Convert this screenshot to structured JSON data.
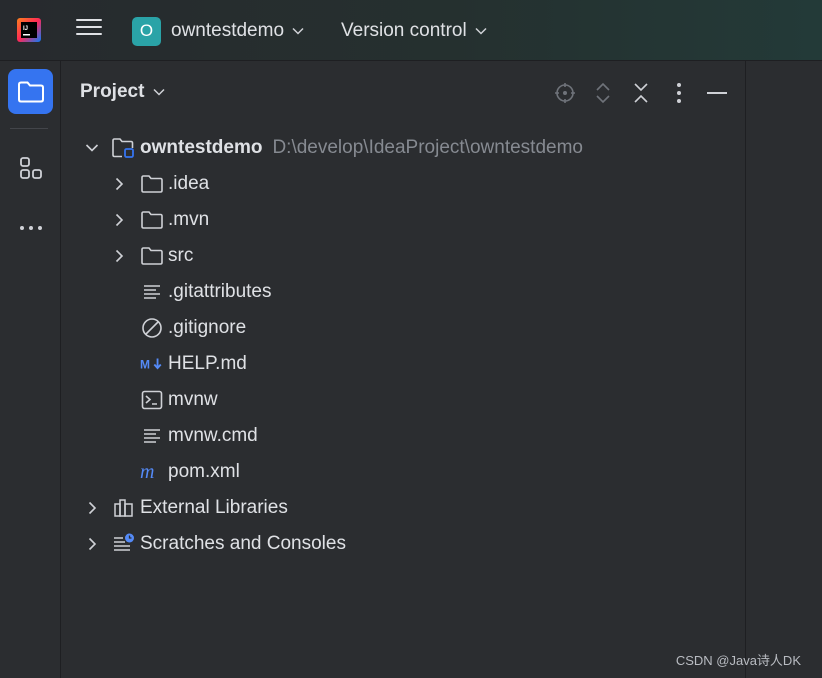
{
  "titlebar": {
    "logo_icon": "intellij-idea-logo",
    "menu_icon": "hamburger-menu-icon",
    "project": {
      "badge": "O",
      "name": "owntestdemo",
      "badge_color": "#2aa3a7"
    },
    "vcs": {
      "label": "Version control"
    }
  },
  "toolstrip": {
    "items": [
      {
        "name": "project",
        "icon": "folder-icon",
        "active": true
      },
      {
        "name": "structure",
        "icon": "structure-icon",
        "active": false
      },
      {
        "name": "more",
        "icon": "more-horizontal-icon",
        "active": false
      }
    ],
    "accent": "#3574f0"
  },
  "panel": {
    "title": "Project",
    "actions": [
      "locate-icon",
      "expand-all-icon",
      "collapse-all-icon",
      "options-icon",
      "hide-icon"
    ]
  },
  "tree": {
    "root": {
      "name": "owntestdemo",
      "path": "D:\\develop\\IdeaProject\\owntestdemo",
      "expanded": true
    },
    "children": [
      {
        "name": ".idea",
        "icon": "folder-icon",
        "expandable": true
      },
      {
        "name": ".mvn",
        "icon": "folder-icon",
        "expandable": true
      },
      {
        "name": "src",
        "icon": "folder-icon",
        "expandable": true
      },
      {
        "name": ".gitattributes",
        "icon": "text-file-icon",
        "expandable": false
      },
      {
        "name": ".gitignore",
        "icon": "ignore-file-icon",
        "expandable": false
      },
      {
        "name": "HELP.md",
        "icon": "markdown-icon",
        "expandable": false
      },
      {
        "name": "mvnw",
        "icon": "shell-script-icon",
        "expandable": false
      },
      {
        "name": "mvnw.cmd",
        "icon": "text-file-icon",
        "expandable": false
      },
      {
        "name": "pom.xml",
        "icon": "maven-icon",
        "expandable": false
      }
    ],
    "external": {
      "name": "External Libraries",
      "icon": "libraries-icon"
    },
    "scratches": {
      "name": "Scratches and Consoles",
      "icon": "scratches-icon"
    }
  },
  "watermark": "CSDN @Java诗人DK"
}
